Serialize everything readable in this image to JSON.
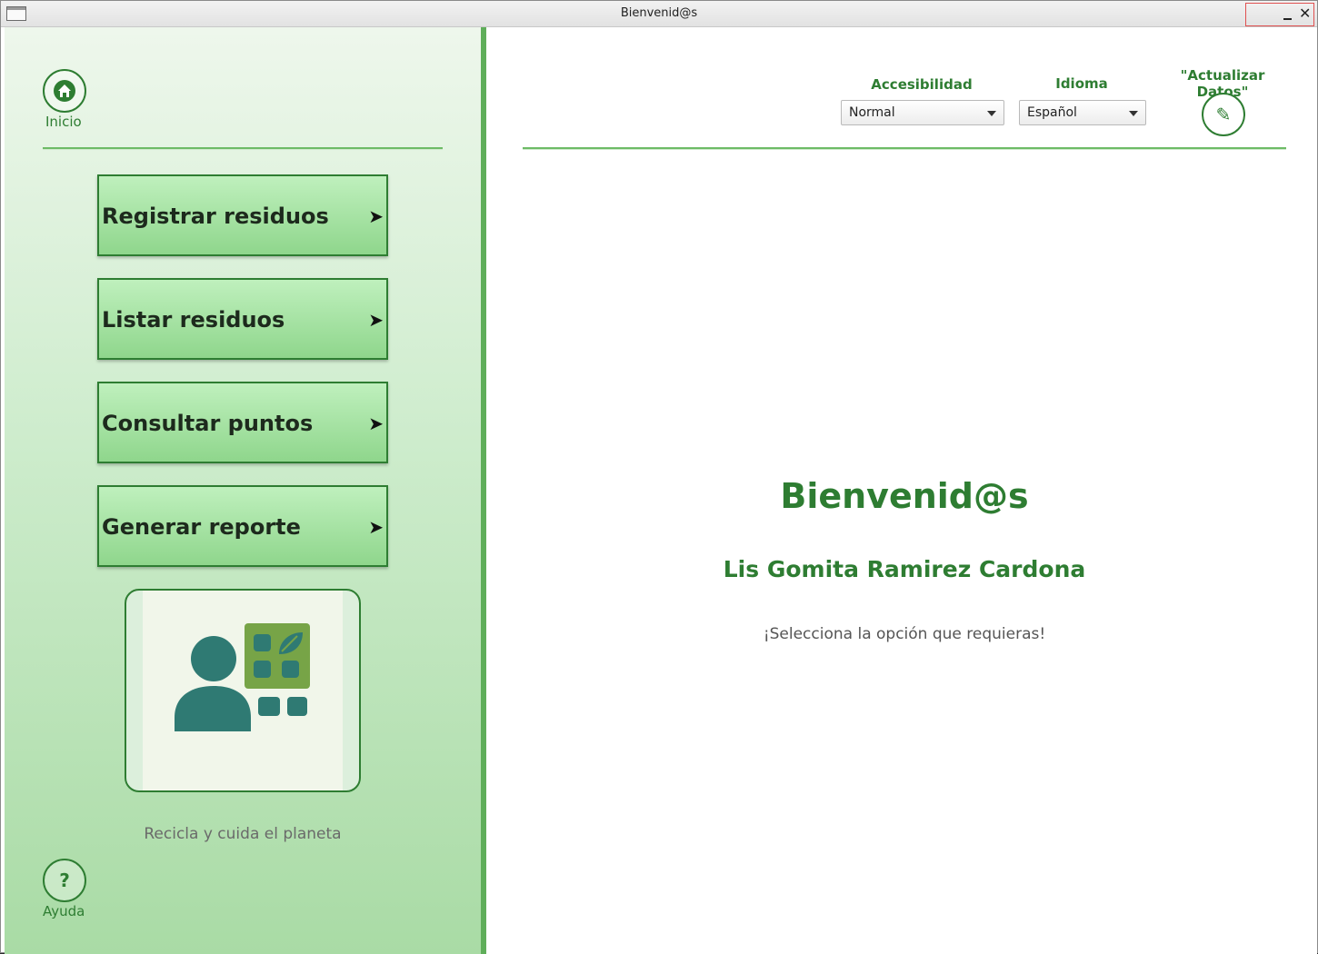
{
  "window": {
    "title": "Bienvenid@s"
  },
  "sidebar": {
    "home_label": "Inicio",
    "help_symbol": "?",
    "help_label": "Ayuda",
    "menu": [
      {
        "label": "Registrar residuos",
        "arrow": "➤"
      },
      {
        "label": "Listar residuos",
        "arrow": "➤"
      },
      {
        "label": "Consultar puntos",
        "arrow": "➤"
      },
      {
        "label": "Generar reporte",
        "arrow": "➤"
      }
    ],
    "tagline": "Recicla y cuida el planeta"
  },
  "header": {
    "accessibility_label": "Accesibilidad",
    "accessibility_value": "Normal",
    "language_label": "Idioma",
    "language_value": "Español",
    "update_label": "\"Actualizar Datos\"",
    "edit_symbol": "✎"
  },
  "content": {
    "welcome": "Bienvenid@s",
    "user_name": "Lis Gomita Ramirez Cardona",
    "instruction": "¡Selecciona la opción que requieras!"
  },
  "colors": {
    "accent": "#2e7d32",
    "sidebar_edge": "#5fae5a",
    "illustration_person": "#2f7a73",
    "illustration_panel": "#77a447"
  },
  "icons": {
    "home": "home-icon",
    "help": "question-icon",
    "edit": "pencil-icon",
    "menu_arrow": "arrow-right-icon"
  }
}
